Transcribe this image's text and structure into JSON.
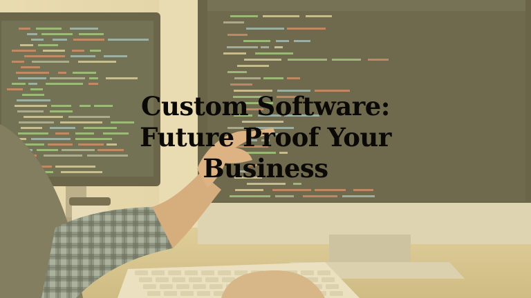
{
  "headline": {
    "line1": "Custom Software:",
    "line2": "Future Proof Your",
    "line3": "Business"
  },
  "colors": {
    "overlay_tint": "#e9d696",
    "headline_text": "#0b0906",
    "screen_dark": "#1a1f1c",
    "code_green": "#7fd07a",
    "code_red": "#d0614a",
    "code_blue": "#7fb8d8"
  },
  "scene": {
    "subject": "person-pointing-at-code-on-monitor",
    "icons": [
      "monitor-icon",
      "keyboard-icon",
      "coffee-cup-icon",
      "hand-icon"
    ]
  }
}
